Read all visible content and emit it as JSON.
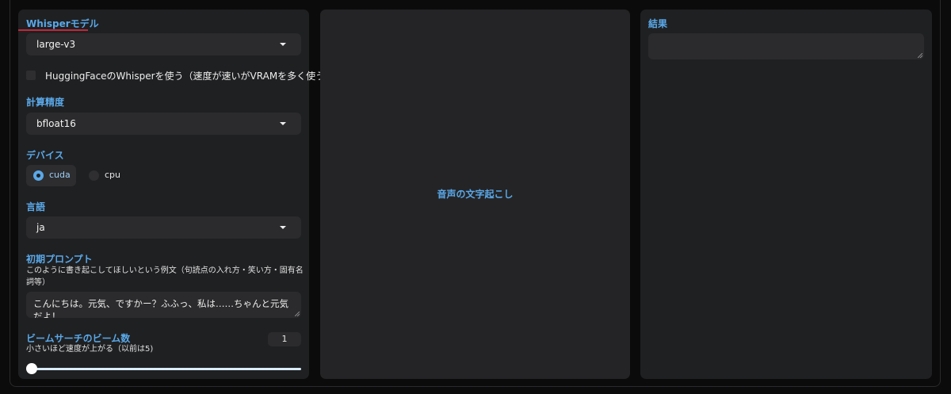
{
  "left": {
    "model": {
      "label": "Whisperモデル",
      "value": "large-v3"
    },
    "hf_checkbox": {
      "label": "HuggingFaceのWhisperを使う（速度が速いがVRAMを多く使う）",
      "checked": false
    },
    "precision": {
      "label": "計算精度",
      "value": "bfloat16"
    },
    "device": {
      "label": "デバイス",
      "options": [
        "cuda",
        "cpu"
      ],
      "selected": "cuda"
    },
    "language": {
      "label": "言語",
      "value": "ja"
    },
    "prompt": {
      "label": "初期プロンプト",
      "info": "このように書き起こしてほしいという例文（句読点の入れ方・笑い方・固有名詞等）",
      "value": "こんにちは。元気、ですかー？ふふっ、私は……ちゃんと元気だよ！"
    },
    "beam": {
      "label": "ビームサーチのビーム数",
      "info": "小さいほど速度が上がる（以前は5)",
      "value": "1",
      "fraction": 0.0
    }
  },
  "middle": {
    "button_label": "音声の文字起こし"
  },
  "right": {
    "result_label": "結果",
    "result_value": ""
  },
  "colors": {
    "accent": "#5aa8e8",
    "underline": "#c2273a",
    "panel": "#1f2022"
  }
}
